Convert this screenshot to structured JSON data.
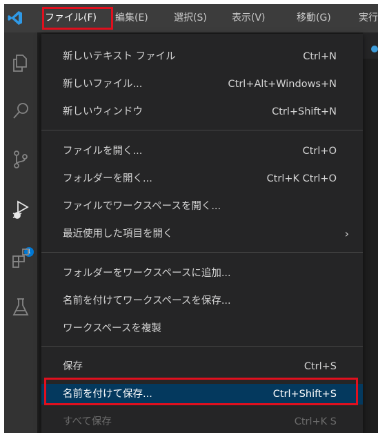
{
  "menubar": {
    "items": [
      {
        "label": "ファイル(F)"
      },
      {
        "label": "編集(E)"
      },
      {
        "label": "選択(S)"
      },
      {
        "label": "表示(V)"
      },
      {
        "label": "移動(G)"
      },
      {
        "label": "実行"
      }
    ]
  },
  "activity": {
    "badge_count": "1",
    "icons": [
      "explorer-icon",
      "search-icon",
      "source-control-icon",
      "run-debug-icon",
      "extensions-icon",
      "testing-icon"
    ]
  },
  "file_menu": {
    "groups": [
      [
        {
          "label": "新しいテキスト ファイル",
          "shortcut": "Ctrl+N"
        },
        {
          "label": "新しいファイル...",
          "shortcut": "Ctrl+Alt+Windows+N"
        },
        {
          "label": "新しいウィンドウ",
          "shortcut": "Ctrl+Shift+N"
        }
      ],
      [
        {
          "label": "ファイルを開く...",
          "shortcut": "Ctrl+O"
        },
        {
          "label": "フォルダーを開く...",
          "shortcut": "Ctrl+K Ctrl+O"
        },
        {
          "label": "ファイルでワークスペースを開く...",
          "shortcut": ""
        },
        {
          "label": "最近使用した項目を開く",
          "shortcut": "",
          "submenu": true
        }
      ],
      [
        {
          "label": "フォルダーをワークスペースに追加...",
          "shortcut": ""
        },
        {
          "label": "名前を付けてワークスペースを保存...",
          "shortcut": ""
        },
        {
          "label": "ワークスペースを複製",
          "shortcut": ""
        }
      ],
      [
        {
          "label": "保存",
          "shortcut": "Ctrl+S"
        },
        {
          "label": "名前を付けて保存...",
          "shortcut": "Ctrl+Shift+S",
          "highlighted": true
        },
        {
          "label": "すべて保存",
          "shortcut": "Ctrl+K S",
          "disabled": true
        }
      ]
    ]
  },
  "colors": {
    "highlight_box": "#e0101e",
    "selection_bg": "#04395e",
    "menu_bg": "#252526",
    "accent": "#0078d4"
  }
}
